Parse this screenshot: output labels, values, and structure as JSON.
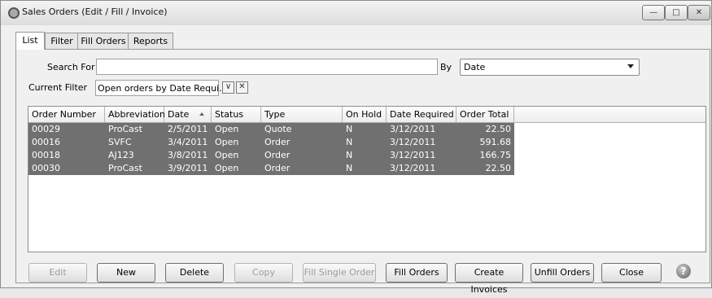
{
  "window": {
    "title": "Sales Orders (Edit / Fill / Invoice)"
  },
  "tabs": [
    {
      "label": "List",
      "active": true
    },
    {
      "label": "Filter",
      "active": false
    },
    {
      "label": "Fill Orders",
      "active": false
    },
    {
      "label": "Reports",
      "active": false
    }
  ],
  "search": {
    "label": "Search For",
    "value": ""
  },
  "by": {
    "label": "By",
    "selected": "Date"
  },
  "current_filter": {
    "label": "Current Filter",
    "value": "Open orders by Date Requi..."
  },
  "grid": {
    "columns": [
      "Order Number",
      "Abbreviation",
      "Date",
      "Status",
      "Type",
      "On Hold",
      "Date Required",
      "Order Total"
    ],
    "sort_column": "Date",
    "rows": [
      [
        "00029",
        "ProCast",
        "2/5/2011",
        "Open",
        "Quote",
        "N",
        "3/12/2011",
        "22.50"
      ],
      [
        "00016",
        "SVFC",
        "3/4/2011",
        "Open",
        "Order",
        "N",
        "3/12/2011",
        "591.68"
      ],
      [
        "00018",
        "AJ123",
        "3/8/2011",
        "Open",
        "Order",
        "N",
        "3/12/2011",
        "166.75"
      ],
      [
        "00030",
        "ProCast",
        "3/9/2011",
        "Open",
        "Order",
        "N",
        "3/12/2011",
        "22.50"
      ]
    ]
  },
  "buttons": {
    "edit": "Edit",
    "new": "New",
    "delete": "Delete",
    "copy": "Copy",
    "fill_single": "Fill Single Order",
    "fill_orders": "Fill Orders",
    "create_invoices": "Create Invoices",
    "unfill_orders": "Unfill Orders",
    "close": "Close"
  },
  "colors": {
    "selected_row": "#707070",
    "window_bg": "#f0f0f0"
  }
}
